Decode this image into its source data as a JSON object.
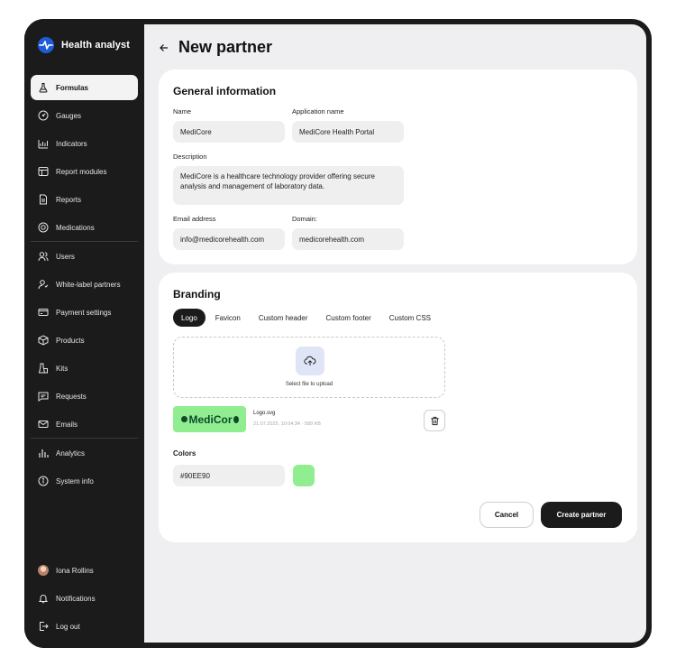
{
  "app": {
    "name": "Health analyst"
  },
  "sidebar": {
    "items": [
      {
        "label": "Formulas",
        "icon": "flask-icon"
      },
      {
        "label": "Gauges",
        "icon": "gauge-icon"
      },
      {
        "label": "Indicators",
        "icon": "chart-line-icon"
      },
      {
        "label": "Report modules",
        "icon": "layout-icon"
      },
      {
        "label": "Reports",
        "icon": "document-icon"
      },
      {
        "label": "Medications",
        "icon": "pill-icon"
      },
      {
        "label": "Users",
        "icon": "users-icon"
      },
      {
        "label": "White-label partners",
        "icon": "partner-icon"
      },
      {
        "label": "Payment settings",
        "icon": "payment-icon"
      },
      {
        "label": "Products",
        "icon": "box-icon"
      },
      {
        "label": "Kits",
        "icon": "kit-icon"
      },
      {
        "label": "Requests",
        "icon": "message-icon"
      },
      {
        "label": "Emails",
        "icon": "mail-icon"
      },
      {
        "label": "Analytics",
        "icon": "bar-chart-icon"
      },
      {
        "label": "System info",
        "icon": "info-icon"
      }
    ],
    "active": "Formulas",
    "user": {
      "name": "Iona Rollins"
    },
    "notifications_label": "Notifications",
    "logout_label": "Log out"
  },
  "page": {
    "title": "New partner"
  },
  "general": {
    "title": "General information",
    "name_label": "Name",
    "name_value": "MediCore",
    "app_name_label": "Application name",
    "app_name_value": "MediCore Health Portal",
    "description_label": "Description",
    "description_value": "MediCore is a healthcare technology provider offering secure analysis and management of laboratory data.",
    "email_label": "Email address",
    "email_value": "info@medicorehealth.com",
    "domain_label": "Domain:",
    "domain_value": "medicorehealth.com"
  },
  "branding": {
    "title": "Branding",
    "tabs": [
      "Logo",
      "Favicon",
      "Custom header",
      "Custom footer",
      "Custom CSS"
    ],
    "active_tab": "Logo",
    "upload_text": "Select file to upload",
    "logo_text": "MediCor",
    "file_name": "Logo.svg",
    "file_meta": "21.07.2025, 10:04:34 · 589 KB",
    "colors_label": "Colors",
    "color_value": "#90EE90",
    "color_hex": "#90EE90"
  },
  "actions": {
    "cancel": "Cancel",
    "create": "Create partner"
  }
}
